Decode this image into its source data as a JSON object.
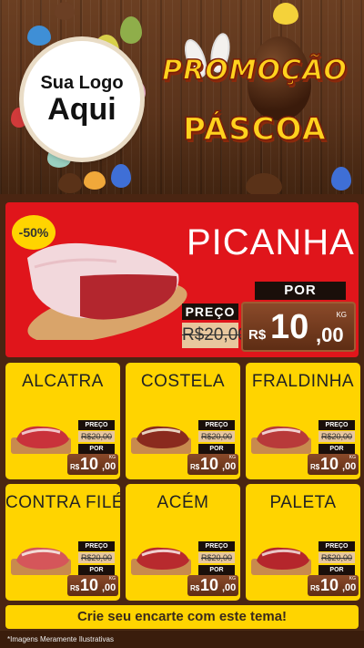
{
  "logo": {
    "line1": "Sua Logo",
    "line2": "Aqui"
  },
  "promo": {
    "title": "PROMOÇÃO",
    "subtitle": "PÁSCOA"
  },
  "hero": {
    "badge": "-50%",
    "name": "PICANHA",
    "preco_label": "PREÇO",
    "old_price": "R$20,00",
    "por_label": "POR",
    "currency": "R$",
    "price_int": "10",
    "price_dec": ",00",
    "unit": "KG"
  },
  "products": [
    {
      "name": "ALCATRA",
      "preco_label": "PREÇO",
      "old_price": "R$20,00",
      "por_label": "POR",
      "currency": "R$",
      "price_int": "10",
      "price_dec": ",00",
      "unit": "KG"
    },
    {
      "name": "COSTELA",
      "preco_label": "PREÇO",
      "old_price": "R$20,00",
      "por_label": "POR",
      "currency": "R$",
      "price_int": "10",
      "price_dec": ",00",
      "unit": "KG"
    },
    {
      "name": "FRALDINHA",
      "preco_label": "PREÇO",
      "old_price": "R$20,00",
      "por_label": "POR",
      "currency": "R$",
      "price_int": "10",
      "price_dec": ",00",
      "unit": "KG"
    },
    {
      "name": "CONTRA FILÉ",
      "preco_label": "PREÇO",
      "old_price": "R$20,00",
      "por_label": "POR",
      "currency": "R$",
      "price_int": "10",
      "price_dec": ",00",
      "unit": "KG"
    },
    {
      "name": "ACÉM",
      "preco_label": "PREÇO",
      "old_price": "R$20,00",
      "por_label": "POR",
      "currency": "R$",
      "price_int": "10",
      "price_dec": ",00",
      "unit": "KG"
    },
    {
      "name": "PALETA",
      "preco_label": "PREÇO",
      "old_price": "R$20,00",
      "por_label": "POR",
      "currency": "R$",
      "price_int": "10",
      "price_dec": ",00",
      "unit": "KG"
    }
  ],
  "cta": "Crie seu encarte com este tema!",
  "footnote": "*Imagens Meramente Ilustrativas",
  "colors": {
    "yellow": "#ffd400",
    "red": "#e0151b",
    "brown": "#4a2512",
    "chocolate": "#5e2d14"
  }
}
